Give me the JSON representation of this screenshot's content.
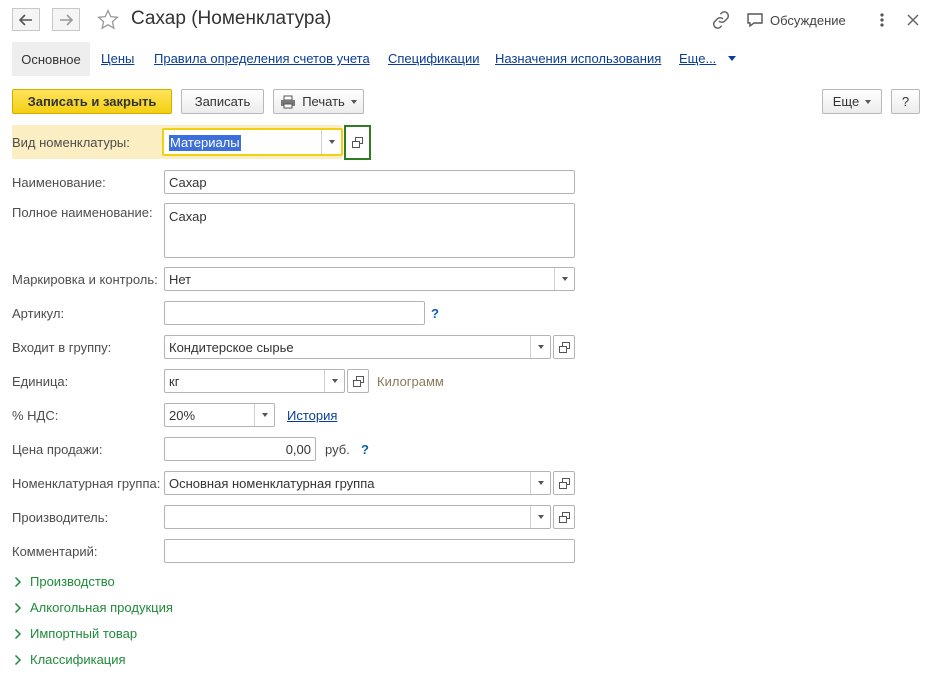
{
  "window": {
    "title": "Сахар (Номенклатура)",
    "discussion_label": "Обсуждение"
  },
  "tabs": {
    "active": "Основное",
    "links": [
      "Цены",
      "Правила определения счетов учета",
      "Спецификации",
      "Назначения использования"
    ],
    "more": "Еще..."
  },
  "toolbar": {
    "save_close": "Записать и закрыть",
    "save": "Записать",
    "print": "Печать",
    "more": "Еще",
    "help": "?"
  },
  "form": {
    "kind": {
      "label": "Вид номенклатуры:",
      "value": "Материалы"
    },
    "name": {
      "label": "Наименование:",
      "value": "Сахар"
    },
    "full_name": {
      "label": "Полное наименование:",
      "value": "Сахар"
    },
    "marking": {
      "label": "Маркировка и контроль:",
      "value": "Нет"
    },
    "article": {
      "label": "Артикул:",
      "value": "",
      "hint": "?"
    },
    "group": {
      "label": "Входит в группу:",
      "value": "Кондитерское сырье"
    },
    "unit": {
      "label": "Единица:",
      "value": "кг",
      "caption": "Килограмм"
    },
    "vat": {
      "label": "% НДС:",
      "value": "20%",
      "history": "История"
    },
    "price": {
      "label": "Цена продажи:",
      "value": "0,00",
      "currency": "руб.",
      "hint": "?"
    },
    "nom_group": {
      "label": "Номенклатурная группа:",
      "value": "Основная номенклатурная группа"
    },
    "producer": {
      "label": "Производитель:",
      "value": ""
    },
    "comment": {
      "label": "Комментарий:",
      "value": ""
    }
  },
  "sections": [
    "Производство",
    "Алкогольная продукция",
    "Импортный товар",
    "Классификация"
  ],
  "colors": {
    "accent_yellow": "#f3cf12",
    "highlight_row": "#fbeec3",
    "link_blue": "#0a3d96",
    "section_green": "#1f8a3b",
    "selection_blue": "#3d6fd8",
    "focus_green": "#2f7d21"
  }
}
